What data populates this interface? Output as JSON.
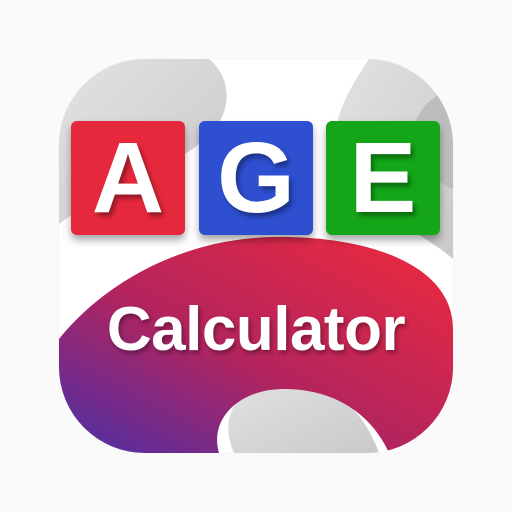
{
  "icon": {
    "letters": [
      {
        "char": "A",
        "color": "#e5283c"
      },
      {
        "char": "G",
        "color": "#2d4fd0"
      },
      {
        "char": "E",
        "color": "#14a519"
      }
    ],
    "subtitle": "Calculator",
    "colors": {
      "tile_background": "#ffffff",
      "grey_shape": "#d8d8d8",
      "swoosh_start": "#4a2fa8",
      "swoosh_mid": "#c3235c",
      "swoosh_end": "#f02a3c",
      "text": "#ffffff"
    }
  }
}
